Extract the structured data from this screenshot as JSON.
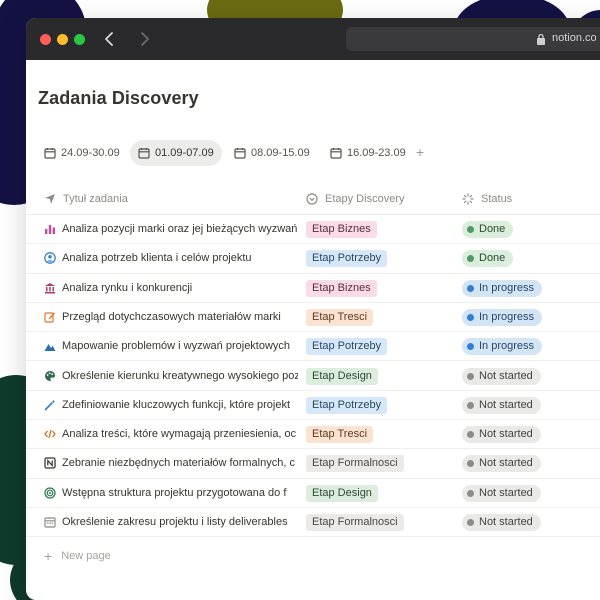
{
  "browser": {
    "url": "notion.co"
  },
  "page": {
    "title": "Zadania Discovery",
    "tabs": [
      {
        "label": "24.09-30.09",
        "active": false
      },
      {
        "label": "01.09-07.09",
        "active": true
      },
      {
        "label": "08.09-15.09",
        "active": false
      },
      {
        "label": "16.09-23.09",
        "active": false
      }
    ],
    "add_tab_label": "+",
    "columns": {
      "name": "Tytuł zadania",
      "etap": "Etapy Discovery",
      "status": "Status"
    },
    "rows": [
      {
        "icon": "bar-chart-icon",
        "name": "Analiza pozycji marki oraz jej bieżących wyzwań",
        "etap": "Etap Biznes",
        "status": "Done"
      },
      {
        "icon": "user-circle-icon",
        "name": "Analiza potrzeb klienta i celów projektu",
        "etap": "Etap Potrzeby",
        "status": "Done"
      },
      {
        "icon": "bank-icon",
        "name": "Analiza rynku i konkurencji",
        "etap": "Etap Biznes",
        "status": "In progress"
      },
      {
        "icon": "edit-icon",
        "name": "Przegląd dotychczasowych materiałów marki",
        "etap": "Etap Tresci",
        "status": "In progress"
      },
      {
        "icon": "mountain-icon",
        "name": "Mapowanie problemów i wyzwań projektowych",
        "etap": "Etap Potrzeby",
        "status": "In progress"
      },
      {
        "icon": "palette-icon",
        "name": "Określenie kierunku kreatywnego wysokiego poziomu",
        "etap": "Etap Design",
        "status": "Not started"
      },
      {
        "icon": "magic-wand-icon",
        "name": "Zdefiniowanie kluczowych funkcji, które projekt",
        "etap": "Etap Potrzeby",
        "status": "Not started"
      },
      {
        "icon": "code-icon",
        "name": "Analiza treści, które wymagają przeniesienia, oc",
        "etap": "Etap Tresci",
        "status": "Not started"
      },
      {
        "icon": "notion-icon",
        "name": "Zebranie niezbędnych materiałów formalnych, c",
        "etap": "Etap Formalnosci",
        "status": "Not started"
      },
      {
        "icon": "target-icon",
        "name": "Wstępna struktura projektu przygotowana do f",
        "etap": "Etap Design",
        "status": "Not started"
      },
      {
        "icon": "calendar-icon",
        "name": "Określenie zakresu projektu i listy deliverables",
        "etap": "Etap Formalnosci",
        "status": "Not started"
      }
    ],
    "new_page_label": "New page"
  },
  "colors": {
    "etap": {
      "Etap Biznes": {
        "bg": "#fadce8",
        "fg": "#5a2c3f"
      },
      "Etap Potrzeby": {
        "bg": "#d6e8f7",
        "fg": "#284866"
      },
      "Etap Tresci": {
        "bg": "#fbe3d1",
        "fg": "#5e3a1f"
      },
      "Etap Design": {
        "bg": "#dcedde",
        "fg": "#2b4a30"
      },
      "Etap Formalnosci": {
        "bg": "#ebeae8",
        "fg": "#4a4844"
      }
    },
    "status": {
      "Done": {
        "bg": "#dbeddb",
        "fg": "#2c4a31",
        "dot": "#4f9768"
      },
      "In progress": {
        "bg": "#d3e5f5",
        "fg": "#28456c",
        "dot": "#2f80d4"
      },
      "Not started": {
        "bg": "#e9e9e7",
        "fg": "#45433f",
        "dot": "#8d8b87"
      }
    },
    "icons": {
      "bar-chart-icon": "#c44a9a",
      "user-circle-icon": "#3a84c9",
      "bank-icon": "#b03a72",
      "edit-icon": "#e0782a",
      "mountain-icon": "#2f6fb0",
      "palette-icon": "#2f6b4f",
      "magic-wand-icon": "#2f7cc2",
      "code-icon": "#d46f1a",
      "notion-icon": "#37352f",
      "target-icon": "#2e7c52",
      "calendar-icon": "#8d8b87"
    }
  }
}
